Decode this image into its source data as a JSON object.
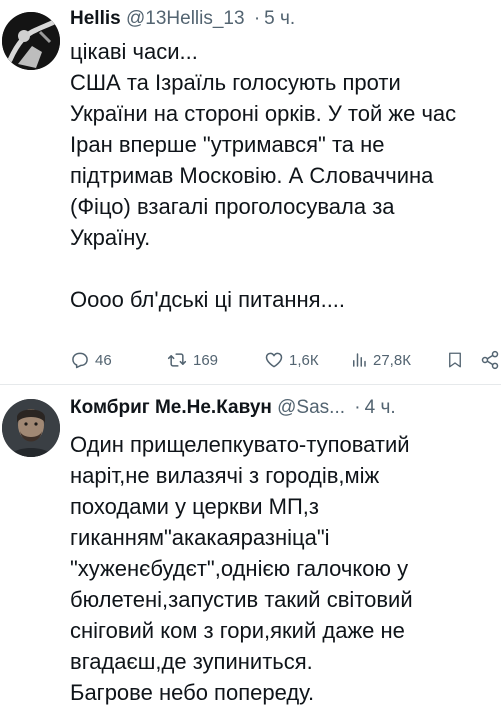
{
  "tweets": [
    {
      "author_name": "Hellis",
      "handle": "@13Hellis_13",
      "separator": "·",
      "time": "5 ч.",
      "lines": [
        "цікаві часи...",
        "США та Ізраїль голосують проти",
        "України на стороні орків. У той же час",
        "Іран вперше \"утримався\" та не",
        "підтримав Московію. А Словаччина",
        "(Фіцо) взагалі проголосувала за",
        "Україну.",
        "",
        "Оооо бл'дські ці питання...."
      ],
      "stats": {
        "replies": "46",
        "retweets": "169",
        "likes": "1,6К",
        "views": "27,8К"
      }
    },
    {
      "author_name": "Комбриг Ме.Не.Кавун",
      "handle": "@Sas...",
      "separator": "·",
      "time": "4 ч.",
      "lines": [
        "Один прищелепкувато-туповатий",
        "наріт,не вилазячі з городів,між",
        "походами у церкви МП,з",
        "гиканням\"акакаяразніца\"і",
        "\"хуженєбудєт\",однією галочкою у",
        "бюлетені,запустив такий світовий",
        "сніговий ком з гори,який даже не",
        "вгадаєш,де зупиниться.",
        "Багрове небо попереду."
      ]
    }
  ],
  "icons": {
    "reply": "reply-icon",
    "retweet": "retweet-icon",
    "like": "heart-icon",
    "views": "views-icon",
    "bookmark": "bookmark-icon",
    "share": "share-icon"
  },
  "colors": {
    "text": "#0f1419",
    "secondary": "#536471",
    "divider": "#e6e9eb"
  }
}
